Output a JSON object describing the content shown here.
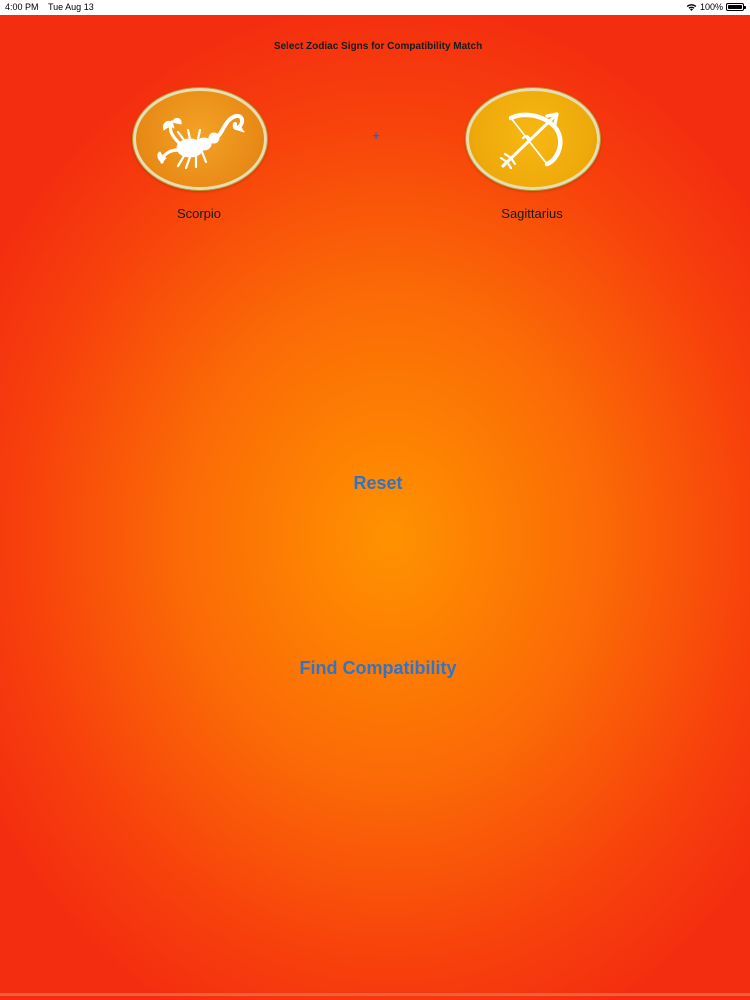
{
  "status_bar": {
    "time": "4:00 PM",
    "date": "Tue Aug 13",
    "battery": "100%",
    "battery_level": 1.0,
    "icons": [
      "wifi-icon",
      "battery-icon"
    ]
  },
  "screen": {
    "title": "Select Zodiac Signs for Compatibility Match",
    "colors": {
      "background_center": "#ff9200",
      "background_edge": "#f32d10",
      "button_text": "#2f74c8",
      "plus": "#4a5aa8"
    }
  },
  "signs": {
    "first": {
      "label": "Scorpio",
      "icon": "scorpion-icon"
    },
    "separator": "+",
    "second": {
      "label": "Sagittarius",
      "icon": "bow-and-arrow-icon"
    }
  },
  "buttons": {
    "reset": "Reset",
    "find_compatibility": "Find Compatibility"
  }
}
